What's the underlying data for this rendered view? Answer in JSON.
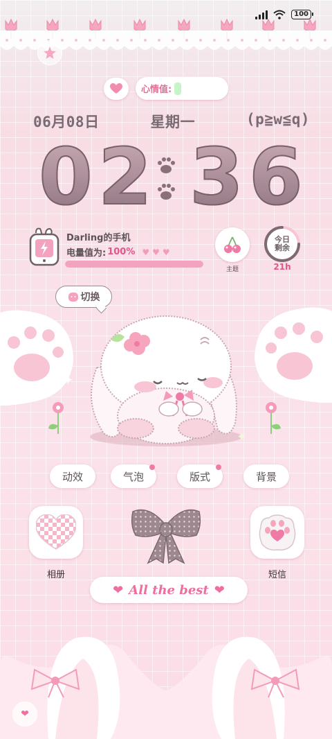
{
  "status_bar": {
    "battery": "100"
  },
  "mood": {
    "label": "心情值:"
  },
  "date": {
    "date_text": "06月08日",
    "weekday": "星期一",
    "kaomoji": "(p≧w≦q)"
  },
  "clock": {
    "hours": "02",
    "minutes": "36"
  },
  "phone": {
    "title": "Darling的手机",
    "power_label": "电量值为:",
    "power_value": "100%",
    "level": 1.0
  },
  "widgets": {
    "theme_label": "主题",
    "today_label_1": "今日",
    "today_label_2": "剩余",
    "today_hours": "21h"
  },
  "switch": {
    "label": "切换"
  },
  "pills": [
    "动效",
    "气泡",
    "版式",
    "背景"
  ],
  "apps": {
    "album": "相册",
    "sms": "短信"
  },
  "banner": {
    "text": "All the best"
  },
  "colors": {
    "accent_pink": "#ee6f9f",
    "bg_pink": "#fbe2e9",
    "clock_mauve": "#8f7480"
  }
}
